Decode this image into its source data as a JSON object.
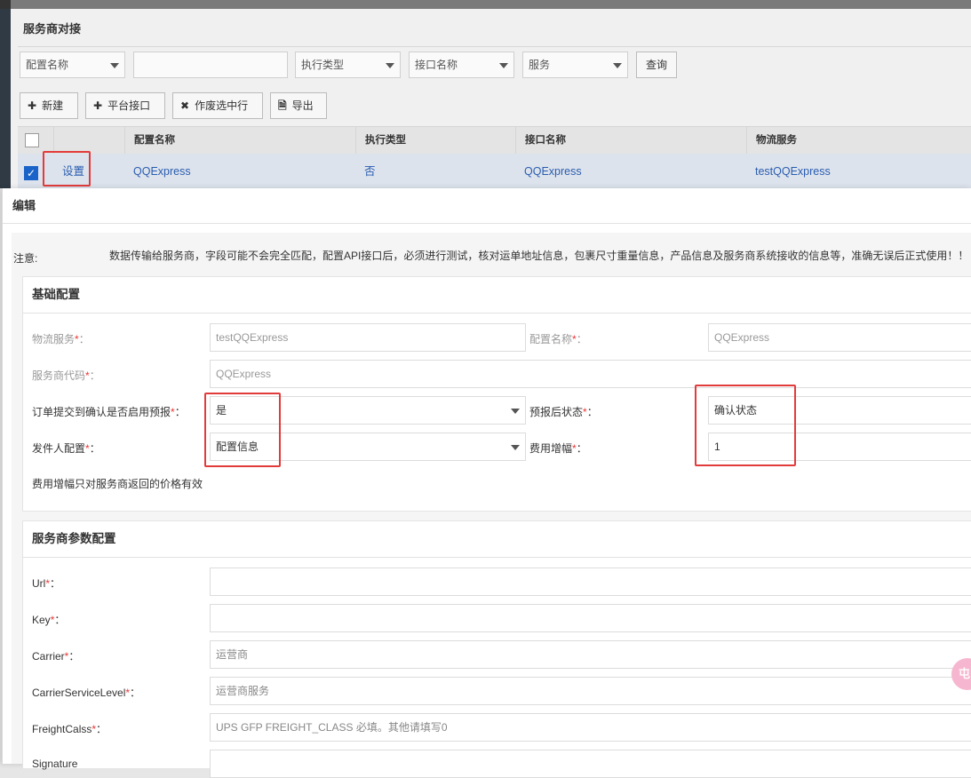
{
  "page": {
    "title": "服务商对接",
    "filters": {
      "config_name_select": "配置名称",
      "config_name_input": "",
      "exec_type_select": "执行类型",
      "api_name_select": "接口名称",
      "service_select": "服务",
      "query_button": "查询"
    },
    "toolbar": {
      "new_button": "新建",
      "platform_api_button": "平台接口",
      "void_selected_button": "作废选中行",
      "export_button": "导出"
    },
    "table": {
      "columns": [
        "配置名称",
        "执行类型",
        "接口名称",
        "物流服务"
      ],
      "row": {
        "checked": true,
        "action": "设置",
        "config_name": "QQExpress",
        "exec_type": "否",
        "api_name": "QQExpress",
        "logistics_service": "testQQExpress"
      }
    }
  },
  "modal": {
    "title": "编辑",
    "note_label": "注意:",
    "note_text": "数据传输给服务商，字段可能不会完全匹配，配置API接口后，必须进行测试，核对运单地址信息，包裹尺寸重量信息，产品信息及服务商系统接收的信息等，准确无误后正式使用！！",
    "basic": {
      "title": "基础配置",
      "logistics_service_label": "物流服务",
      "logistics_service_value": "testQQExpress",
      "config_name_label": "配置名称",
      "config_name_value": "QQExpress",
      "provider_code_label": "服务商代码",
      "provider_code_value": "QQExpress",
      "enable_prereport_label": "订单提交到确认是否启用预报",
      "enable_prereport_value": "是",
      "post_report_status_label": "预报后状态",
      "post_report_status_value": "确认状态",
      "sender_config_label": "发件人配置",
      "sender_config_value": "配置信息",
      "fee_increase_label": "费用增幅",
      "fee_increase_value": "1",
      "fee_hint": "费用增幅只对服务商返回的价格有效",
      "label_suffix": "：",
      "required_mark": "*"
    },
    "params": {
      "title": "服务商参数配置",
      "url_label": "Url",
      "url_value": "",
      "key_label": "Key",
      "key_value": "",
      "carrier_label": "Carrier",
      "carrier_placeholder": "运营商",
      "carrier_service_level_label": "CarrierServiceLevel",
      "carrier_service_level_placeholder": "运营商服务",
      "freight_class_label": "FreightCalss",
      "freight_class_placeholder": "UPS GFP FREIGHT_CLASS 必填。其他请填写0",
      "signature_label": "Signature"
    }
  },
  "float_button": "屯"
}
